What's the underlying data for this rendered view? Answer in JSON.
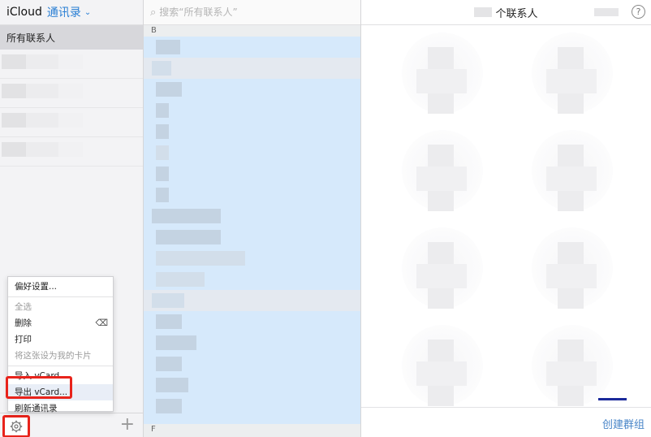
{
  "sidebar": {
    "brand": "iCloud",
    "app_name": "通讯录",
    "chevron": "⌄",
    "all_contacts": "所有联系人"
  },
  "menu": {
    "items": [
      {
        "label": "偏好设置...",
        "enabled": true
      },
      {
        "label": "全选",
        "enabled": false
      },
      {
        "label": "删除",
        "enabled": true
      },
      {
        "label": "打印",
        "enabled": true
      },
      {
        "label": "将这张设为我的卡片",
        "enabled": false
      },
      {
        "label": "导入 vCard...",
        "enabled": true
      },
      {
        "label": "导出 vCard...",
        "enabled": true,
        "highlighted": true
      },
      {
        "label": "刷新通讯录",
        "enabled": true
      }
    ]
  },
  "footer": {
    "add_symbol": "+"
  },
  "search": {
    "placeholder": "搜索“所有联系人”"
  },
  "list": {
    "section_b": "B",
    "section_f": "F"
  },
  "detail": {
    "count_suffix": "个联系人",
    "help": "?",
    "new_group": "创建群组"
  },
  "icons": [
    "gear-icon",
    "plus-icon",
    "search-icon",
    "help-icon",
    "delete-key-icon"
  ]
}
